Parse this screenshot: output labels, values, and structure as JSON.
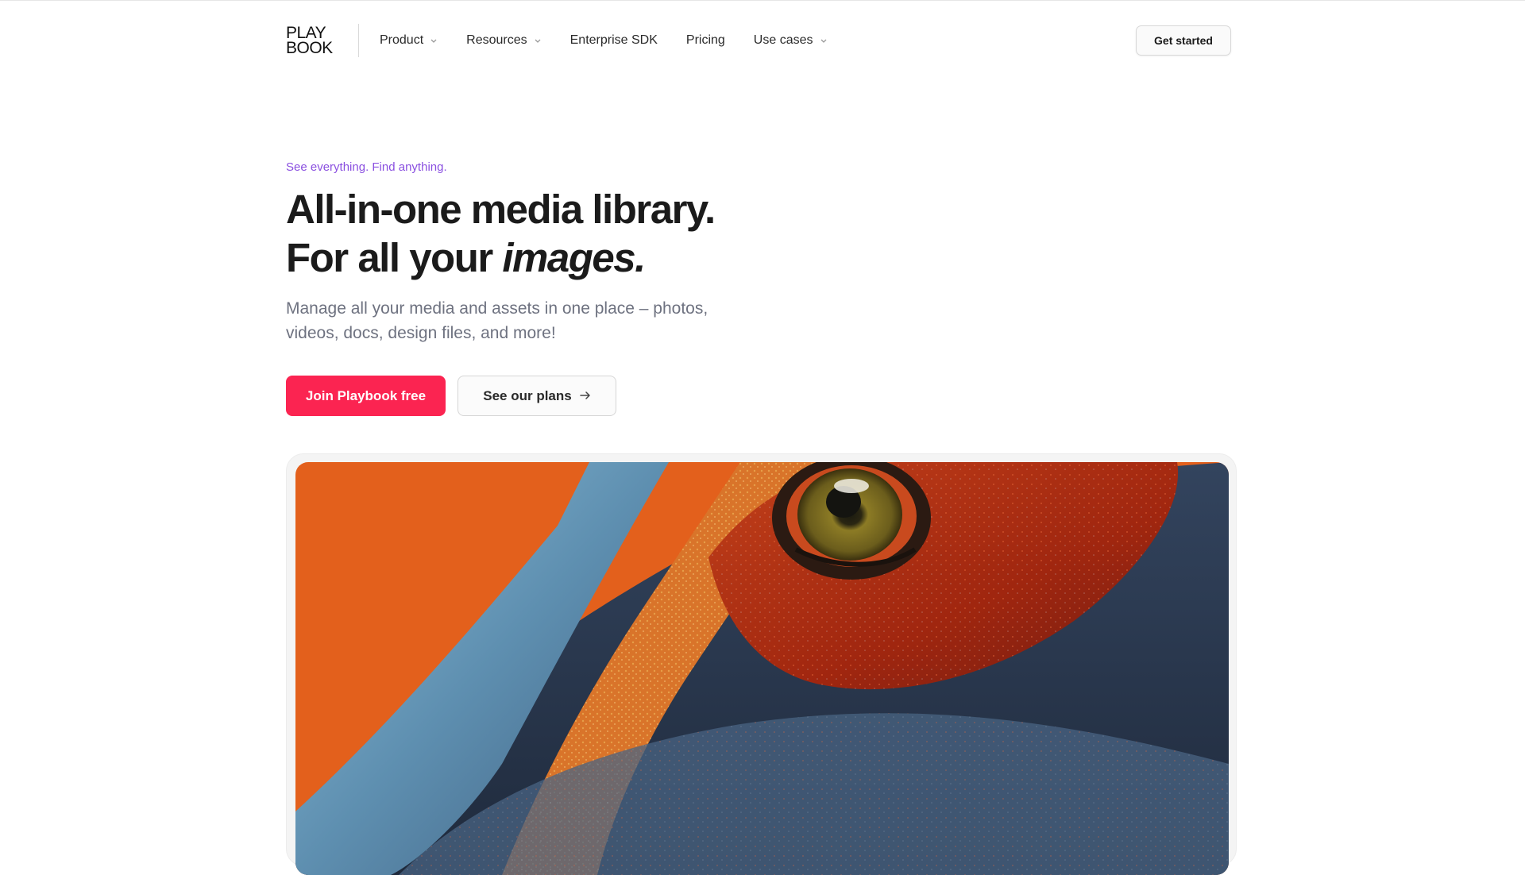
{
  "brand": {
    "logo_line1": "PLAY",
    "logo_line2": "BOOK"
  },
  "nav": {
    "items": [
      {
        "label": "Product",
        "has_dropdown": true
      },
      {
        "label": "Resources",
        "has_dropdown": true
      },
      {
        "label": "Enterprise SDK",
        "has_dropdown": false
      },
      {
        "label": "Pricing",
        "has_dropdown": false
      },
      {
        "label": "Use cases",
        "has_dropdown": true
      }
    ],
    "cta_label": "Get started"
  },
  "hero": {
    "tagline": "See everything. Find anything.",
    "headline_line1": "All-in-one media library.",
    "headline_line2_prefix": "For all your ",
    "headline_line2_emphasis": "images.",
    "subtext": "Manage all your media and assets in one place – photos, videos, docs, design files, and more!",
    "primary_cta": "Join Playbook free",
    "secondary_cta": "See our plans",
    "secondary_cta_icon": "arrow-right-icon"
  },
  "showcase": {
    "image_subject": "close-up of a colorful reptile eye",
    "colors": {
      "background": "#e3601c",
      "blue_skin": "#6fa4c4",
      "orange_skin": "#d9742a",
      "red_skin": "#a62c14",
      "dark_skin": "#2e3e55",
      "eye": "#8a7a26"
    }
  },
  "colors": {
    "accent": "#fb2451",
    "tagline": "#8a4fe0",
    "text": "#1b1b1b",
    "muted": "#6e7280"
  }
}
